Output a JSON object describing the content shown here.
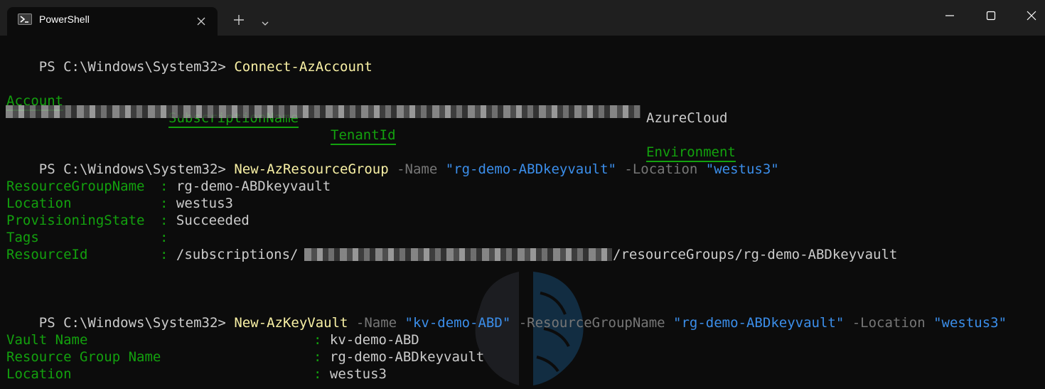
{
  "window": {
    "tab_title": "PowerShell",
    "icons": {
      "tab_icon": "powershell-icon",
      "close": "close-icon",
      "new_tab": "plus-icon",
      "dropdown": "chevron-down-icon",
      "minimize": "minimize-icon",
      "maximize": "maximize-icon",
      "window_close": "close-icon"
    }
  },
  "colors": {
    "background": "#0c0c0c",
    "titlebar": "#1f1f1f",
    "command": "#f9f1a5",
    "parameter": "#767676",
    "string": "#3b8eea",
    "key_green": "#13a10e",
    "text": "#cccccc"
  },
  "terminal": {
    "cmd1": {
      "prompt": "PS C:\\Windows\\System32> ",
      "command": "Connect-AzAccount"
    },
    "table1": {
      "headers": [
        "Account",
        "SubscriptionName",
        "TenantId",
        "Environment"
      ],
      "row": {
        "environment": "AzureCloud"
      }
    },
    "cmd2": {
      "prompt": "PS C:\\Windows\\System32> ",
      "command": "New-AzResourceGroup",
      "p1": " -Name ",
      "v1": "\"rg-demo-ABDkeyvault\"",
      "p2": " -Location ",
      "v2": "\"westus3\""
    },
    "rg": {
      "k1": "ResourceGroupName",
      "v1": "rg-demo-ABDkeyvault",
      "k2": "Location",
      "v2": "westus3",
      "k3": "ProvisioningState",
      "v3": "Succeeded",
      "k4": "Tags",
      "v4": "",
      "k5": "ResourceId",
      "v5a": "/subscriptions/",
      "v5b": "/resourceGroups/rg-demo-ABDkeyvault",
      "sep": ":"
    },
    "cmd3": {
      "prompt": "PS C:\\Windows\\System32> ",
      "command": "New-AzKeyVault",
      "p1": " -Name ",
      "v1": "\"kv-demo-ABD\"",
      "p2": " -ResourceGroupName ",
      "v2": "\"rg-demo-ABDkeyvault\"",
      "p3": " -Location ",
      "v3": "\"westus3\""
    },
    "kv": {
      "k1": "Vault Name",
      "v1": "kv-demo-ABD",
      "k2": "Resource Group Name",
      "v2": "rg-demo-ABDkeyvault",
      "k3": "Location",
      "v3": "westus3",
      "sep": ":"
    }
  }
}
